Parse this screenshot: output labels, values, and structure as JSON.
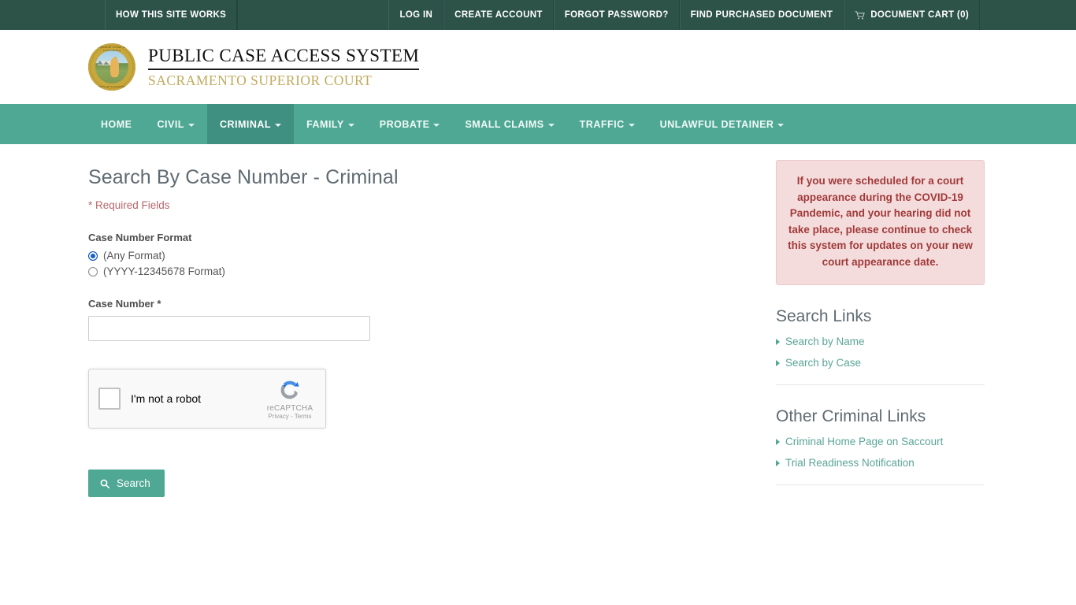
{
  "topbar": {
    "items": [
      {
        "label": "HOW THIS SITE WORKS",
        "icon": ""
      },
      {
        "label": "LOG IN",
        "icon": ""
      },
      {
        "label": "CREATE ACCOUNT",
        "icon": ""
      },
      {
        "label": "FORGOT PASSWORD?",
        "icon": ""
      },
      {
        "label": "FIND PURCHASED DOCUMENT",
        "icon": ""
      },
      {
        "label": "DOCUMENT CART (0)",
        "icon": "cart-icon"
      }
    ]
  },
  "brand": {
    "seal_text_top": "SUPERIOR COURT OF CALIFORNIA",
    "seal_text_bottom": "COUNTY OF SACRAMENTO",
    "title": "PUBLIC CASE ACCESS SYSTEM",
    "subtitle": "SACRAMENTO SUPERIOR COURT"
  },
  "nav": {
    "items": [
      {
        "label": "HOME",
        "has_caret": false,
        "active": false
      },
      {
        "label": "CIVIL",
        "has_caret": true,
        "active": false
      },
      {
        "label": "CRIMINAL",
        "has_caret": true,
        "active": true
      },
      {
        "label": "FAMILY",
        "has_caret": true,
        "active": false
      },
      {
        "label": "PROBATE",
        "has_caret": true,
        "active": false
      },
      {
        "label": "SMALL CLAIMS",
        "has_caret": true,
        "active": false
      },
      {
        "label": "TRAFFIC",
        "has_caret": true,
        "active": false
      },
      {
        "label": "UNLAWFUL DETAINER",
        "has_caret": true,
        "active": false
      }
    ]
  },
  "form": {
    "page_title": "Search By Case Number - Criminal",
    "required_note": "* Required Fields",
    "format_label": "Case Number Format",
    "radio_any_label": "(Any Format)",
    "radio_any_checked": true,
    "radio_yyyy_label": "(YYYY-12345678 Format)",
    "radio_yyyy_checked": false,
    "case_number_label": "Case Number *",
    "case_number_value": "",
    "case_number_placeholder": "",
    "search_button_label": "Search",
    "search_icon": "magnifier-icon"
  },
  "recaptcha": {
    "checkbox_label": "I'm not a robot",
    "brand_name": "reCAPTCHA",
    "privacy_label": "Privacy",
    "terms_label": "Terms",
    "separator": "-",
    "checked": false
  },
  "sidebar": {
    "alert_text": "If you were scheduled for a court appearance during the COVID-19 Pandemic, and your hearing did not take place, please continue to check this system for updates on your new court appearance date.",
    "sections": [
      {
        "title": "Search Links",
        "links": [
          {
            "label": "Search by Name"
          },
          {
            "label": "Search by Case"
          }
        ]
      },
      {
        "title": "Other Criminal Links",
        "links": [
          {
            "label": "Criminal Home Page on Saccourt"
          },
          {
            "label": "Trial Readiness Notification"
          }
        ]
      }
    ]
  },
  "colors": {
    "topbar_bg": "#2d5349",
    "nav_bg": "#4fa894",
    "nav_active_bg": "#3f9080",
    "accent_teal": "#4fa894",
    "link_teal": "#5aa596",
    "alert_bg": "#f5dcdc",
    "alert_text": "#a03a3a",
    "gold": "#c2aa5e",
    "radio_selected": "#1161d6"
  }
}
